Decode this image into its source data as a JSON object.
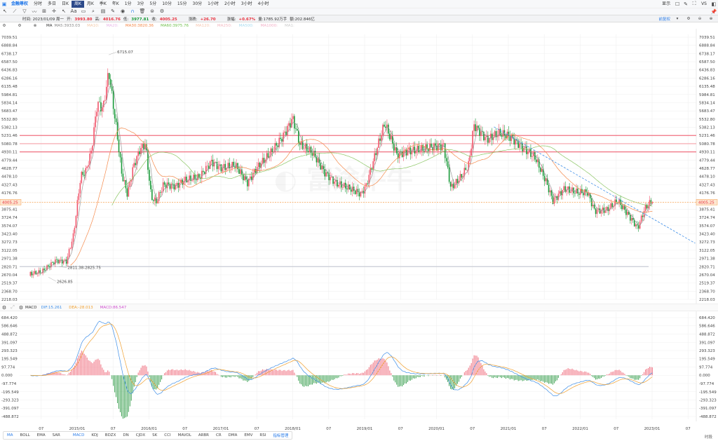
{
  "topbar": {
    "brand": "金融尊权",
    "periods": [
      "分时",
      "多日",
      "日K",
      "周K",
      "月K",
      "季K",
      "年K",
      "1分",
      "3分",
      "5分",
      "10分",
      "15分",
      "30分",
      "1小时",
      "2小时",
      "3小时",
      "4小时"
    ],
    "active_period": "周K",
    "right": {
      "display_label": "显示",
      "vs_label": "VS"
    }
  },
  "drawing_tools": [
    "cursor-icon",
    "line-icon",
    "channel-icon",
    "wave-icon",
    "measure-icon",
    "crosshair-icon",
    "arrow-icon",
    "text-icon",
    "comment-icon",
    "zoom-icon",
    "chart-icon",
    "pen-icon",
    "eye-icon",
    "magnet-icon",
    "trash-icon",
    "layers-icon",
    "settings-icon"
  ],
  "info": {
    "time": "时间: 2023/01/09 周一",
    "open_label": "开:",
    "open": "3993.80",
    "high_label": "高:",
    "high": "4016.76",
    "low_label": "低:",
    "low": "3977.81",
    "close_label": "收:",
    "close": "4005.25",
    "change_label": "涨跌:",
    "change": "+26.70",
    "pct_label": "涨幅:",
    "pct": "+0.67%",
    "volume": "量:1785.92万手",
    "amount": "额:202.846亿"
  },
  "ma_bar": {
    "name": "MA",
    "items": [
      {
        "label": "MA5:3933.03",
        "color": "#888888"
      },
      {
        "label": "MA10:",
        "color": "#f4c9a8"
      },
      {
        "label": "MA20:",
        "color": "#e9b8e9"
      },
      {
        "label": "MA30:3820.36",
        "color": "#f5894a"
      },
      {
        "label": "MA60:3975.76",
        "color": "#6fbf4a"
      },
      {
        "label": "MA120:",
        "color": "#f7c7b0"
      },
      {
        "label": "MA250:",
        "color": "#f4b8c0"
      },
      {
        "label": "MA500:",
        "color": "#a8dcf0"
      },
      {
        "label": "MA1000:",
        "color": "#f2b0c8"
      },
      {
        "label": "MA1:",
        "color": "#cccccc"
      }
    ],
    "adjust_label": "前复权"
  },
  "macd_bar": {
    "name": "MACD",
    "dif": "DIF:15.261",
    "dea": "DEA:-28.013",
    "macd": "MACD:86.547"
  },
  "bottom_tabs": [
    "MA",
    "BOLL",
    "EMA",
    "SAR",
    "MACD",
    "KDJ",
    "BDZX",
    "DN",
    "CJDX",
    "SK",
    "CCI",
    "MAVOL",
    "ARBR",
    "CR",
    "DMA",
    "EMV",
    "RSI",
    "指标管理"
  ],
  "time_label": "时段",
  "colors": {
    "up": "#f0546a",
    "down": "#1a9a3a",
    "ma5": "#999999",
    "ma30": "#f5894a",
    "ma60": "#8cc665",
    "dif": "#3d8ee8",
    "dea": "#f0a030",
    "accent": "#2b7de9"
  },
  "chart_data": {
    "type": "candlestick",
    "period": "weekly",
    "price_axis_labels": [
      "7039.51",
      "6888.84",
      "6738.17",
      "6587.50",
      "6436.83",
      "6286.16",
      "6135.48",
      "5984.81",
      "5834.14",
      "5683.47",
      "5532.80",
      "5382.13",
      "5231.46",
      "5080.78",
      "4930.11",
      "4779.44",
      "4628.77",
      "4478.10",
      "4327.43",
      "4176.76",
      "4005.25",
      "3875.41",
      "3724.74",
      "3574.07",
      "3423.40",
      "3272.73",
      "3122.05",
      "2971.38",
      "2820.71",
      "2670.04",
      "2519.37",
      "2368.70",
      "2218.03"
    ],
    "ylim": [
      2218.03,
      7039.51
    ],
    "last_price": 4005.25,
    "macd_axis_labels": [
      "684.420",
      "586.646",
      "488.872",
      "391.097",
      "293.323",
      "195.549",
      "97.774",
      "0.000",
      "-97.774",
      "-195.549",
      "-293.323",
      "-391.097",
      "-488.872"
    ],
    "macd_ylim": [
      -488.872,
      684.42
    ],
    "x_ticks": [
      "07",
      "2015/01",
      "07",
      "2016/01",
      "07",
      "2017/01",
      "07",
      "2018/01",
      "07",
      "2019/01",
      "07",
      "2020/01",
      "07",
      "2021/01",
      "07",
      "2022/01",
      "07",
      "2023/01",
      "07"
    ],
    "x_tick_dates": [
      2014.5,
      2015,
      2015.5,
      2016,
      2016.5,
      2017,
      2017.5,
      2018,
      2018.5,
      2019,
      2019.5,
      2020,
      2020.5,
      2021,
      2021.5,
      2022,
      2022.5,
      2023,
      2023.5
    ],
    "annotations": [
      {
        "label": "6715.07",
        "date": 2015.44,
        "price": 6715.07
      },
      {
        "label": "2626.85",
        "date": 2014.6,
        "price": 2626.85
      },
      {
        "label": "2811.38-2825.75",
        "date": 2014.75,
        "price": 2818
      }
    ],
    "horizontal_lines": [
      {
        "price": 5231.46,
        "color": "#f07080"
      },
      {
        "price": 5080.78,
        "color": "#f5a0a8"
      },
      {
        "price": 4930.11,
        "color": "#f07080"
      },
      {
        "price": 2820.71,
        "color": "#c8ccd4"
      }
    ],
    "trend_line": {
      "from": [
        2020.8,
        5390
      ],
      "to": [
        2023.6,
        3250
      ],
      "color": "#3d8ee8"
    },
    "close_keypoints": [
      [
        2014.35,
        2650
      ],
      [
        2014.5,
        2680
      ],
      [
        2014.7,
        2900
      ],
      [
        2014.85,
        2900
      ],
      [
        2014.95,
        3400
      ],
      [
        2015.05,
        4500
      ],
      [
        2015.12,
        4600
      ],
      [
        2015.2,
        5000
      ],
      [
        2015.28,
        5900
      ],
      [
        2015.36,
        5800
      ],
      [
        2015.44,
        6500
      ],
      [
        2015.55,
        5400
      ],
      [
        2015.62,
        4600
      ],
      [
        2015.7,
        4200
      ],
      [
        2015.78,
        4700
      ],
      [
        2015.87,
        5000
      ],
      [
        2015.95,
        5100
      ],
      [
        2016.03,
        4100
      ],
      [
        2016.1,
        4000
      ],
      [
        2016.2,
        4300
      ],
      [
        2016.37,
        4250
      ],
      [
        2016.5,
        4350
      ],
      [
        2016.7,
        4400
      ],
      [
        2016.87,
        4700
      ],
      [
        2017.0,
        4600
      ],
      [
        2017.2,
        4700
      ],
      [
        2017.37,
        4400
      ],
      [
        2017.5,
        4700
      ],
      [
        2017.7,
        5000
      ],
      [
        2017.87,
        5300
      ],
      [
        2018.0,
        5600
      ],
      [
        2018.1,
        5100
      ],
      [
        2018.28,
        4900
      ],
      [
        2018.45,
        4500
      ],
      [
        2018.6,
        4300
      ],
      [
        2018.78,
        4200
      ],
      [
        2018.95,
        4100
      ],
      [
        2019.02,
        4250
      ],
      [
        2019.18,
        5000
      ],
      [
        2019.28,
        5450
      ],
      [
        2019.45,
        4900
      ],
      [
        2019.6,
        5000
      ],
      [
        2019.78,
        5050
      ],
      [
        2019.95,
        5100
      ],
      [
        2020.1,
        5100
      ],
      [
        2020.2,
        4300
      ],
      [
        2020.35,
        4500
      ],
      [
        2020.45,
        4700
      ],
      [
        2020.52,
        5400
      ],
      [
        2020.7,
        5100
      ],
      [
        2020.87,
        5200
      ],
      [
        2021.0,
        5150
      ],
      [
        2021.2,
        4950
      ],
      [
        2021.37,
        4800
      ],
      [
        2021.52,
        4400
      ],
      [
        2021.62,
        4050
      ],
      [
        2021.78,
        4300
      ],
      [
        2021.95,
        4250
      ],
      [
        2022.1,
        4250
      ],
      [
        2022.2,
        3900
      ],
      [
        2022.37,
        3900
      ],
      [
        2022.52,
        4050
      ],
      [
        2022.7,
        3700
      ],
      [
        2022.8,
        3500
      ],
      [
        2022.9,
        3850
      ],
      [
        2023.02,
        4005
      ]
    ]
  }
}
